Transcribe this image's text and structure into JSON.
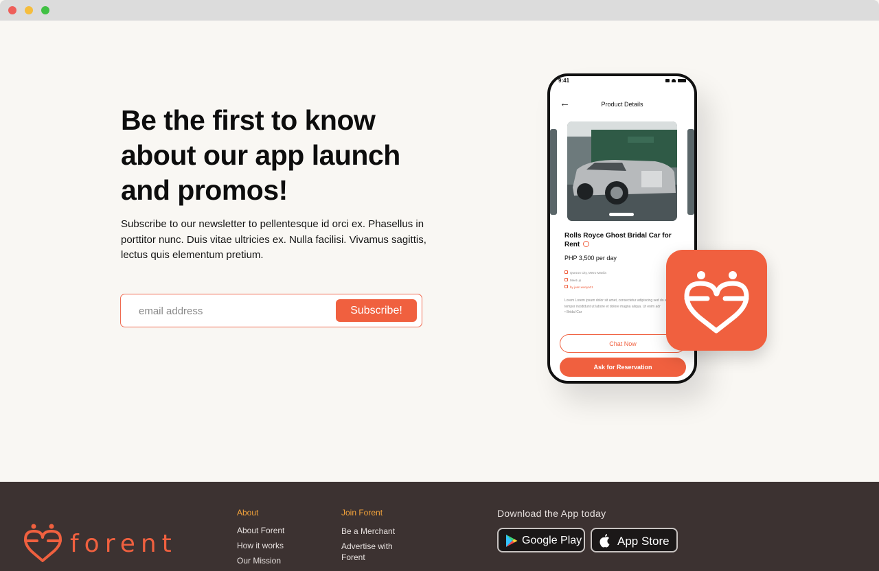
{
  "hero": {
    "headline": "Be the first to know about our app launch and promos!",
    "subtext": "Subscribe to our newsletter to pellentesque id orci ex. Phasellus in porttitor nunc. Duis vitae ultricies ex. Nulla facilisi. Vivamus sagittis, lectus quis elementum pretium.",
    "email_placeholder": "email address",
    "subscribe_label": "Subscribe!"
  },
  "phone": {
    "status_time": "9:41",
    "screen_title": "Product Details",
    "product_name": "Rolls Royce Ghost Bridal Car for Rent",
    "price": "PHP 3,500 per day",
    "location": "Quezon City, Metro Manila",
    "meetup": "Meet up",
    "owner": "by juan.wanya21",
    "description": "Lorem Lorem ipsum dolor sit amet, consectetur adipiscing sed do eiusmod tempor incididunt ut labore et dolore magna aliqua. Ut enim adr",
    "bullet": "•  Bridal Car",
    "chat_label": "Chat Now",
    "reserve_label": "Ask for Reservation"
  },
  "footer": {
    "brand_name": "forent",
    "about": {
      "heading": "About",
      "links": [
        "About Forent",
        "How it works",
        "Our Mission"
      ]
    },
    "join": {
      "heading": "Join Forent",
      "links": [
        "Be a Merchant",
        "Advertise with Forent"
      ]
    },
    "download": {
      "title": "Download the App today",
      "google_play": "Google Play",
      "app_store": "App Store"
    }
  },
  "colors": {
    "brand_orange": "#f0603f",
    "footer_bg": "#3c3231",
    "footer_heading": "#f3a33b",
    "page_bg": "#f9f7f3"
  }
}
